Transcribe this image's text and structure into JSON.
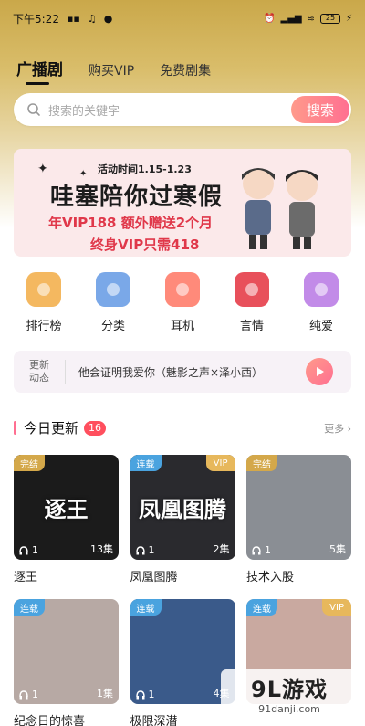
{
  "status_bar": {
    "time": "下午5:22",
    "battery": "25"
  },
  "nav": {
    "tabs": [
      "广播剧",
      "购买VIP",
      "免费剧集"
    ]
  },
  "search": {
    "placeholder": "搜索的关键字",
    "button": "搜索"
  },
  "banner": {
    "date": "活动时间1.15-1.23",
    "headline": "哇塞陪你过寒假",
    "line1": "年VIP188 额外赠送2个月",
    "line2": "终身VIP只需418"
  },
  "categories": [
    {
      "label": "排行榜",
      "icon": "radio-icon",
      "color": "#f4b860"
    },
    {
      "label": "分类",
      "icon": "folder-icon",
      "color": "#7aa8e8"
    },
    {
      "label": "耳机",
      "icon": "plant-icon",
      "color": "#ff8a7a"
    },
    {
      "label": "言情",
      "icon": "lips-icon",
      "color": "#e8505b"
    },
    {
      "label": "纯爱",
      "icon": "lollipop-icon",
      "color": "#c28be8"
    }
  ],
  "ticker": {
    "tag": "更新动态",
    "text": "他会证明我爱你（魅影之声×泽小西）"
  },
  "section": {
    "title": "今日更新",
    "count": "16",
    "more": "更多"
  },
  "items": [
    {
      "name": "逐王",
      "badge": "完结",
      "badge_color": "#d4a84a",
      "vip": "",
      "plays": "1",
      "eps": "13集",
      "cover_title": "逐王",
      "bg": "#1b1b1b"
    },
    {
      "name": "凤凰图腾",
      "badge": "连载",
      "badge_color": "#4aa3df",
      "vip": "VIP",
      "plays": "1",
      "eps": "2集",
      "cover_title": "凤凰图腾",
      "bg": "#2a2a2e"
    },
    {
      "name": "技术入股",
      "badge": "完结",
      "badge_color": "#d4a84a",
      "vip": "",
      "plays": "1",
      "eps": "5集",
      "cover_title": "",
      "bg": "#8a8e94"
    },
    {
      "name": "纪念日的惊喜",
      "badge": "连载",
      "badge_color": "#4aa3df",
      "vip": "",
      "plays": "1",
      "eps": "1集",
      "cover_title": "",
      "bg": "#b7a9a4"
    },
    {
      "name": "极限深潜",
      "badge": "连载",
      "badge_color": "#4aa3df",
      "vip": "",
      "plays": "1",
      "eps": "4集",
      "cover_title": "",
      "bg": "#3a5a8a"
    },
    {
      "name": "",
      "badge": "连载",
      "badge_color": "#4aa3df",
      "vip": "VIP",
      "plays": "",
      "eps": "",
      "cover_title": "",
      "bg": "#c9a9a0"
    }
  ],
  "watermark": {
    "main": "9L游戏",
    "sub": "91danji.com"
  }
}
